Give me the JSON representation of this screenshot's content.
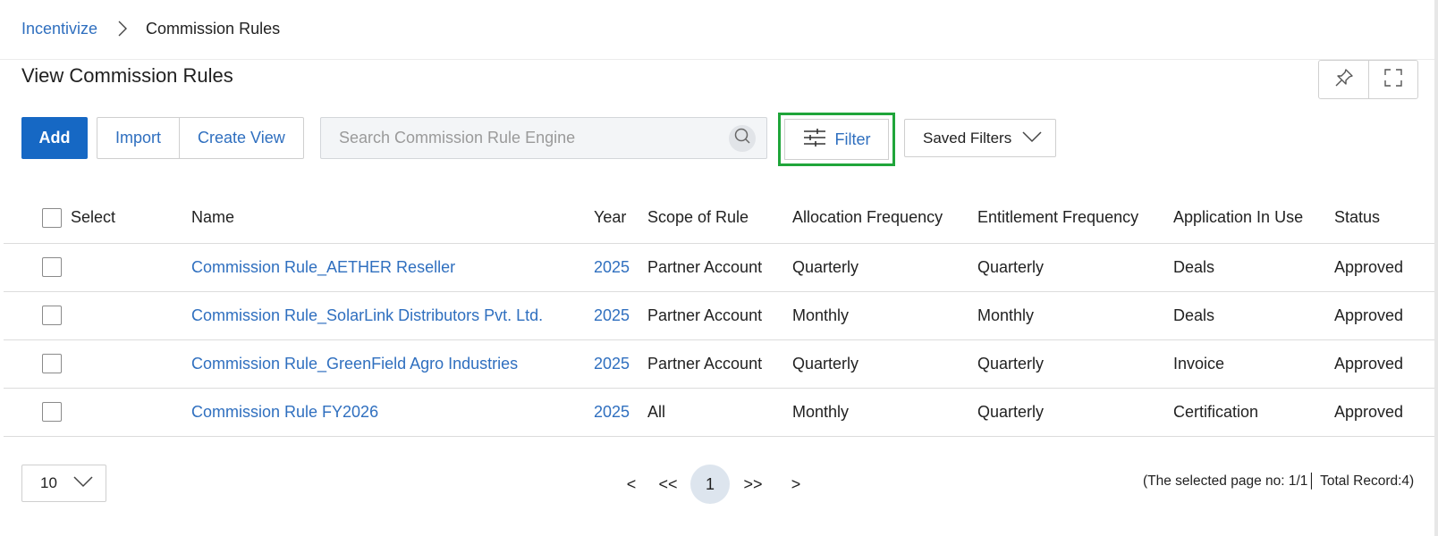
{
  "breadcrumb": {
    "root": "Incentivize",
    "current": "Commission Rules"
  },
  "page": {
    "title": "View Commission Rules"
  },
  "toolbar": {
    "add_label": "Add",
    "import_label": "Import",
    "create_view_label": "Create View",
    "search_placeholder": "Search Commission Rule Engine",
    "search_value": "",
    "filter_label": "Filter",
    "saved_filters_label": "Saved Filters"
  },
  "table": {
    "columns": [
      "Select",
      "Name",
      "Year",
      "Scope of Rule",
      "Allocation Frequency",
      "Entitlement Frequency",
      "Application In Use",
      "Status"
    ],
    "rows": [
      {
        "name": "Commission Rule_AETHER Reseller",
        "year": "2025",
        "scope": "Partner Account",
        "allocation": "Quarterly",
        "entitlement": "Quarterly",
        "application": "Deals",
        "status": "Approved"
      },
      {
        "name": "Commission Rule_SolarLink Distributors Pvt. Ltd.",
        "year": "2025",
        "scope": "Partner Account",
        "allocation": "Monthly",
        "entitlement": "Monthly",
        "application": "Deals",
        "status": "Approved"
      },
      {
        "name": "Commission Rule_GreenField Agro Industries",
        "year": "2025",
        "scope": "Partner Account",
        "allocation": "Quarterly",
        "entitlement": "Quarterly",
        "application": "Invoice",
        "status": "Approved"
      },
      {
        "name": "Commission Rule FY2026",
        "year": "2025",
        "scope": "All",
        "allocation": "Monthly",
        "entitlement": "Quarterly",
        "application": "Certification",
        "status": "Approved"
      }
    ]
  },
  "footer": {
    "page_size": "10",
    "pager": {
      "prev": "<",
      "first": "<<",
      "current": "1",
      "last": ">>",
      "next": ">"
    },
    "record_info": "(The selected page no: 1/1│ Total Record:4)"
  },
  "colors": {
    "primary": "#1668c4",
    "link": "#2f6fbf",
    "highlight": "#1fa53a"
  },
  "icons": [
    "chevron-right-icon",
    "pin-icon",
    "fullscreen-icon",
    "search-icon",
    "filter-sliders-icon",
    "chevron-down-icon"
  ]
}
